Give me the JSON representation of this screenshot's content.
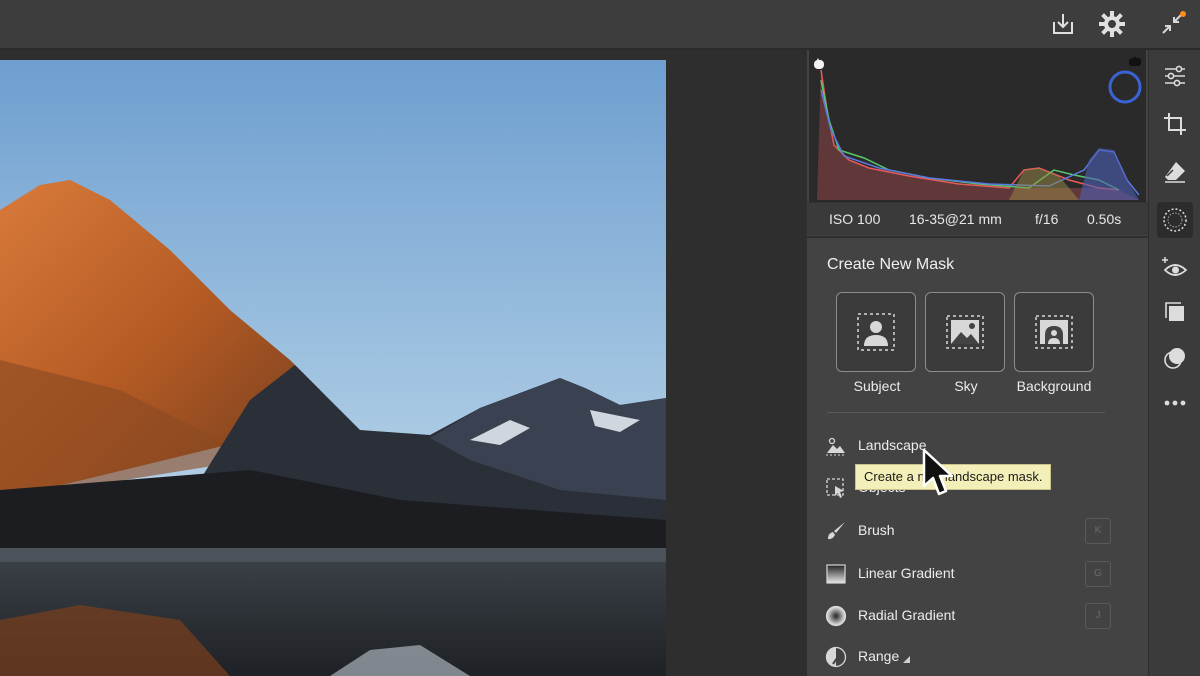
{
  "toolbar": {
    "icons": [
      "export-icon",
      "settings-gear-icon",
      "collapse-arrows-icon"
    ],
    "accent_dot_color": "#ff8a1e"
  },
  "histogram": {
    "exif": {
      "iso": "ISO 100",
      "lens": "16-35@21 mm",
      "aperture": "f/16",
      "shutter": "0.50s"
    }
  },
  "masking": {
    "title": "Create New Mask",
    "cards": [
      {
        "label": "Subject",
        "icon": "subject-person-icon"
      },
      {
        "label": "Sky",
        "icon": "sky-image-icon"
      },
      {
        "label": "Background",
        "icon": "background-arch-icon"
      }
    ],
    "tools": [
      {
        "label": "Landscape",
        "icon": "landscape-icon",
        "shortcut": ""
      },
      {
        "label": "Objects",
        "icon": "objects-select-icon",
        "shortcut": ""
      },
      {
        "label": "Brush",
        "icon": "brush-icon",
        "shortcut": "K"
      },
      {
        "label": "Linear Gradient",
        "icon": "linear-gradient-icon",
        "shortcut": "G"
      },
      {
        "label": "Radial Gradient",
        "icon": "radial-gradient-icon",
        "shortcut": "J"
      },
      {
        "label": "Range",
        "icon": "range-icon",
        "shortcut": ""
      }
    ],
    "tooltip": "Create a new landscape mask."
  },
  "rail": {
    "icons": [
      "edit-sliders-icon",
      "crop-icon",
      "eraser-heal-icon",
      "masking-icon",
      "red-eye-icon",
      "presets-icon",
      "versions-icon",
      "more-icon"
    ],
    "active": "masking-icon"
  }
}
